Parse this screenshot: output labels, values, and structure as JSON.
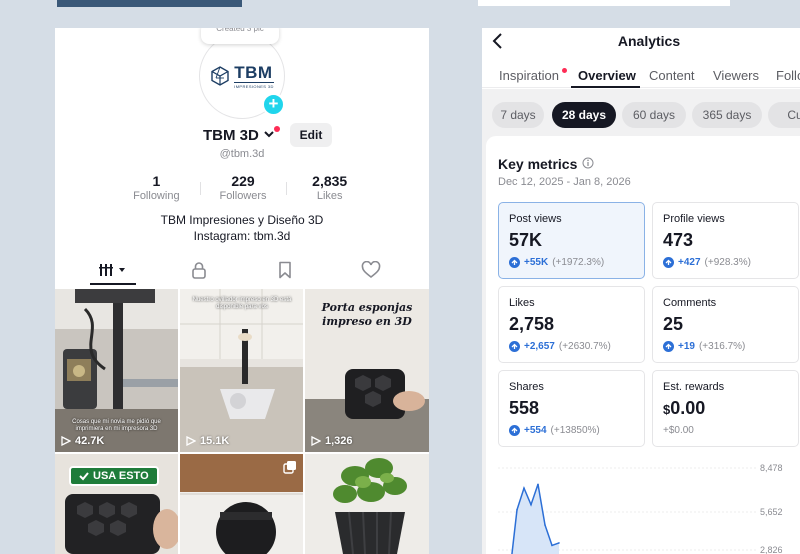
{
  "profile": {
    "tooltip": "Created 3 pic",
    "logo_main": "TBM",
    "logo_sub": "IMPRESIONES 3D",
    "display_name": "TBM 3D",
    "edit_label": "Edit",
    "handle": "@tbm.3d",
    "stats": [
      {
        "value": "1",
        "label": "Following"
      },
      {
        "value": "229",
        "label": "Followers"
      },
      {
        "value": "2,835",
        "label": "Likes"
      }
    ],
    "bio_line1": "TBM Impresiones y Diseño 3D",
    "bio_line2": "Instagram: tbm.3d",
    "videos": [
      {
        "views": "42.7K",
        "caption": "Cosas que mi novia me pidió que imprimiera en mi impresora 3D"
      },
      {
        "views": "15.1K",
        "caption": "Nuestro ovillador impreso en 3D está disponible para vos"
      },
      {
        "views": "1,326",
        "caption": "Porta esponjas impreso en 3D"
      },
      {
        "views": "",
        "caption": "USA ESTO"
      },
      {
        "views": "",
        "caption": ""
      },
      {
        "views": "",
        "caption": ""
      }
    ]
  },
  "analytics": {
    "title": "Analytics",
    "tabs": [
      "Inspiration",
      "Overview",
      "Content",
      "Viewers",
      "Follo"
    ],
    "active_tab": "Overview",
    "ranges": [
      "7 days",
      "28 days",
      "60 days",
      "365 days",
      "Cus"
    ],
    "active_range": "28 days",
    "key_metrics_title": "Key metrics",
    "date_range": "Dec 12, 2025 - Jan 8, 2026",
    "metrics": [
      {
        "label": "Post views",
        "value": "57K",
        "delta": "+55K",
        "pct": "(+1972.3%)"
      },
      {
        "label": "Profile views",
        "value": "473",
        "delta": "+427",
        "pct": "(+928.3%)"
      },
      {
        "label": "Likes",
        "value": "2,758",
        "delta": "+2,657",
        "pct": "(+2630.7%)"
      },
      {
        "label": "Comments",
        "value": "25",
        "delta": "+19",
        "pct": "(+316.7%)"
      },
      {
        "label": "Shares",
        "value": "558",
        "delta": "+554",
        "pct": "(+13850%)"
      },
      {
        "label": "Est. rewards",
        "value_currency": "$",
        "value": "0.00",
        "sub": "+$0.00"
      }
    ],
    "accent_color": "#2c6fd6"
  },
  "chart_data": {
    "type": "area",
    "title": "",
    "xlabel": "",
    "ylabel": "",
    "y_ticks": [
      "8,478",
      "5,652",
      "2,826"
    ],
    "series": [
      {
        "values": [
          400,
          5200,
          6900,
          5600,
          7200,
          4000,
          2400,
          2600
        ]
      }
    ]
  }
}
